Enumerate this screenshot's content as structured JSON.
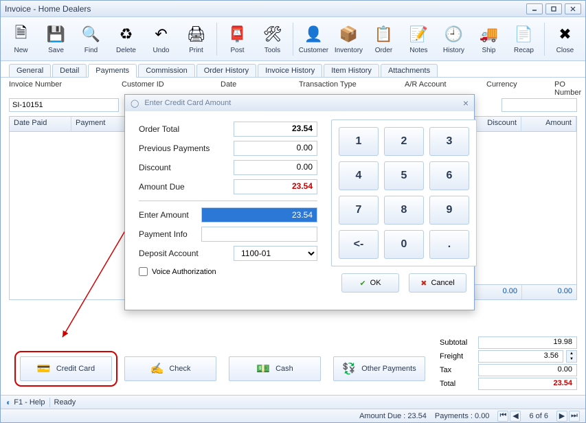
{
  "window_title": "Invoice - Home Dealers",
  "toolbar": [
    {
      "name": "new",
      "label": "New",
      "icon": "🗎"
    },
    {
      "name": "save",
      "label": "Save",
      "icon": "💾"
    },
    {
      "name": "find",
      "label": "Find",
      "icon": "🔍"
    },
    {
      "name": "delete",
      "label": "Delete",
      "icon": "♻"
    },
    {
      "name": "undo",
      "label": "Undo",
      "icon": "↶"
    },
    {
      "name": "print",
      "label": "Print",
      "icon": "🖨"
    },
    {
      "sep": true
    },
    {
      "name": "post",
      "label": "Post",
      "icon": "📮"
    },
    {
      "name": "tools",
      "label": "Tools",
      "icon": "🛠"
    },
    {
      "sep": true
    },
    {
      "name": "customer",
      "label": "Customer",
      "icon": "👤"
    },
    {
      "name": "inventory",
      "label": "Inventory",
      "icon": "📦"
    },
    {
      "name": "order",
      "label": "Order",
      "icon": "📋"
    },
    {
      "name": "notes",
      "label": "Notes",
      "icon": "📝"
    },
    {
      "name": "history",
      "label": "History",
      "icon": "🕘"
    },
    {
      "name": "ship",
      "label": "Ship",
      "icon": "🚚"
    },
    {
      "name": "recap",
      "label": "Recap",
      "icon": "📄"
    },
    {
      "sep": true
    },
    {
      "name": "close",
      "label": "Close",
      "icon": "✖"
    }
  ],
  "tabs": [
    "General",
    "Detail",
    "Payments",
    "Commission",
    "Order History",
    "Invoice History",
    "Item History",
    "Attachments"
  ],
  "active_tab": "Payments",
  "form_header": {
    "invoice_number_label": "Invoice Number",
    "customer_id_label": "Customer ID",
    "date_label": "Date",
    "transaction_type_label": "Transaction Type",
    "ar_account_label": "A/R Account",
    "currency_label": "Currency",
    "po_number_label": "PO Number",
    "invoice_number": "SI-10151"
  },
  "grid_columns": [
    "Date Paid",
    "Payment",
    "",
    "",
    "Discount",
    "Amount"
  ],
  "grid_totals": {
    "discount": "0.00",
    "amount": "0.00"
  },
  "payment_buttons": [
    {
      "name": "credit-card",
      "label": "Credit Card",
      "icon": "💳",
      "highlight": true
    },
    {
      "name": "check",
      "label": "Check",
      "icon": "✍"
    },
    {
      "name": "cash",
      "label": "Cash",
      "icon": "💵"
    },
    {
      "name": "other",
      "label": "Other Payments",
      "icon": "💱"
    }
  ],
  "totals": {
    "subtotal_label": "Subtotal",
    "subtotal": "19.98",
    "freight_label": "Freight",
    "freight": "3.56",
    "tax_label": "Tax",
    "tax": "0.00",
    "total_label": "Total",
    "total": "23.54"
  },
  "footer": {
    "help": "F1 - Help",
    "ready": "Ready"
  },
  "status": {
    "amount_due_label": "Amount Due :",
    "amount_due": "23.54",
    "payments_label": "Payments :",
    "payments": "0.00",
    "rec_pos": "6",
    "rec_total": "6",
    "of": "of"
  },
  "modal": {
    "title": "Enter Credit Card Amount",
    "order_total_label": "Order Total",
    "order_total": "23.54",
    "prev_pay_label": "Previous Payments",
    "prev_pay": "0.00",
    "discount_label": "Discount",
    "discount": "0.00",
    "amount_due_label": "Amount Due",
    "amount_due": "23.54",
    "enter_amount_label": "Enter Amount",
    "enter_amount": "23.54",
    "payment_info_label": "Payment Info",
    "payment_info": "",
    "deposit_account_label": "Deposit Account",
    "deposit_account": "1100-01",
    "voice_auth_label": "Voice Authorization",
    "keypad": [
      "1",
      "2",
      "3",
      "4",
      "5",
      "6",
      "7",
      "8",
      "9",
      "<-",
      "0",
      "."
    ],
    "ok": "OK",
    "cancel": "Cancel"
  }
}
